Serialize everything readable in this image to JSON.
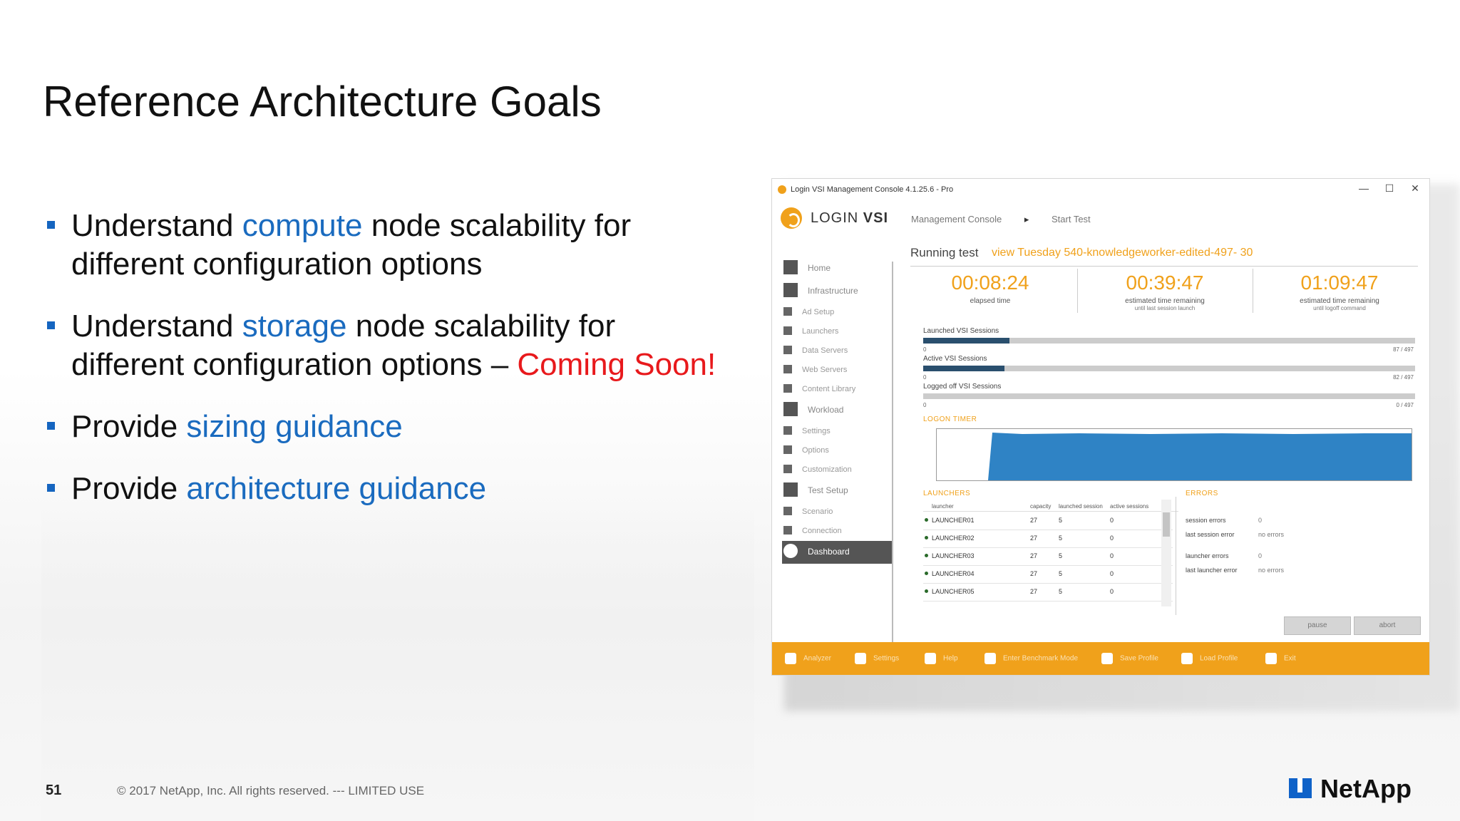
{
  "slide": {
    "title": "Reference Architecture Goals",
    "bullets": [
      {
        "pre": "Understand ",
        "hl": "compute",
        "post": " node scalability for",
        "line2_pre": "different configuration options",
        "line2_red": ""
      },
      {
        "pre": "Understand ",
        "hl": "storage",
        "post": " node scalability for",
        "line2_pre": "different configuration options – ",
        "line2_red": "Coming Soon!"
      },
      {
        "pre": "Provide ",
        "hl": "sizing guidance"
      },
      {
        "pre": "Provide ",
        "hl": "architecture guidance"
      }
    ],
    "page_number": "51",
    "copyright": "© 2017 NetApp, Inc. All rights reserved.  ---  LIMITED USE",
    "brand": "NetApp"
  },
  "console": {
    "window_title": "Login VSI Management Console 4.1.25.6 - Pro",
    "window_controls": {
      "minimize": "—",
      "maximize": "☐",
      "close": "✕"
    },
    "brand": {
      "part1": "LOGIN ",
      "part2": "VSI"
    },
    "breadcrumb": [
      "Management Console",
      "▸",
      "Start Test"
    ],
    "running_label": "Running test",
    "running_name": "view Tuesday 540-knowledgeworker-edited-497- 30",
    "sidebar": [
      {
        "label": "Home",
        "main": true
      },
      {
        "label": "Infrastructure",
        "main": true
      },
      {
        "label": "Ad Setup"
      },
      {
        "label": "Launchers"
      },
      {
        "label": "Data Servers"
      },
      {
        "label": "Web Servers"
      },
      {
        "label": "Content Library"
      },
      {
        "label": "Workload",
        "main": true
      },
      {
        "label": "Settings"
      },
      {
        "label": "Options"
      },
      {
        "label": "Customization"
      },
      {
        "label": "Test Setup",
        "main": true
      },
      {
        "label": "Scenario"
      },
      {
        "label": "Connection"
      },
      {
        "label": "Dashboard",
        "main": true,
        "active": true
      }
    ],
    "timers": [
      {
        "value": "00:08:24",
        "label": "elapsed time",
        "sub": ""
      },
      {
        "value": "00:39:47",
        "label": "estimated time remaining",
        "sub": "until last session launch"
      },
      {
        "value": "01:09:47",
        "label": "estimated time remaining",
        "sub": "until logoff command"
      }
    ],
    "sessions": [
      {
        "label": "Launched VSI Sessions",
        "zero": "0",
        "max": "87 / 497",
        "fraction": 0.175
      },
      {
        "label": "Active VSI Sessions",
        "zero": "0",
        "max": "82 / 497",
        "fraction": 0.165
      },
      {
        "label": "Logged off VSI Sessions",
        "zero": "0",
        "max": "0 / 497",
        "fraction": 0.0
      }
    ],
    "logon_title": "LOGON TIMER",
    "launchers_title": "LAUNCHERS",
    "launcher_columns": [
      "launcher",
      "capacity",
      "launched session",
      "active sessions"
    ],
    "launchers": [
      {
        "name": "LAUNCHER01",
        "capacity": "27",
        "launched": "5",
        "active": "0"
      },
      {
        "name": "LAUNCHER02",
        "capacity": "27",
        "launched": "5",
        "active": "0"
      },
      {
        "name": "LAUNCHER03",
        "capacity": "27",
        "launched": "5",
        "active": "0"
      },
      {
        "name": "LAUNCHER04",
        "capacity": "27",
        "launched": "5",
        "active": "0"
      },
      {
        "name": "LAUNCHER05",
        "capacity": "27",
        "launched": "5",
        "active": "0"
      }
    ],
    "errors_title": "ERRORS",
    "errors": [
      {
        "label": "session errors",
        "value": "0"
      },
      {
        "label": "last session error",
        "value": "no errors"
      },
      {
        "label": "launcher errors",
        "value": "0"
      },
      {
        "label": "last launcher error",
        "value": "no errors"
      }
    ],
    "buttons": {
      "pause": "pause",
      "abort": "abort"
    },
    "footer": [
      "Analyzer",
      "Settings",
      "Help",
      "Enter Benchmark Mode",
      "Save Profile",
      "Load Profile",
      "Exit"
    ],
    "accent_color": "#f0a11b"
  }
}
